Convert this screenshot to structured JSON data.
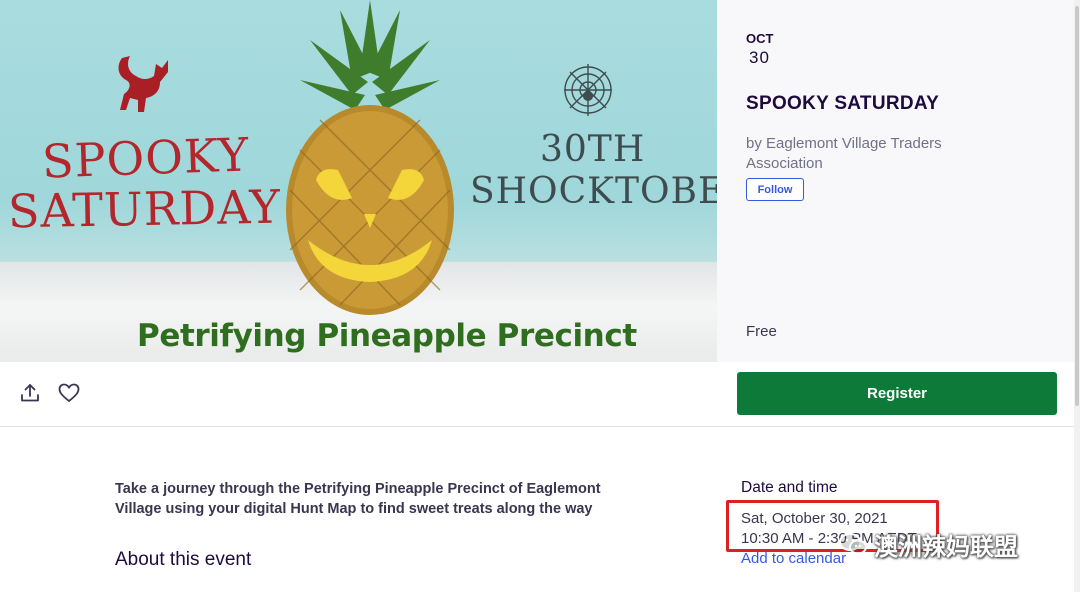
{
  "hero": {
    "title_line1": "SPOOKY",
    "title_line2": "SATURDAY",
    "subtitle_line1": "30TH",
    "subtitle_line2": "SHOCKTOBER",
    "caption": "Petrifying Pineapple Precinct"
  },
  "event": {
    "month": "OCT",
    "day": "30",
    "title": "SPOOKY SATURDAY",
    "organizer": "by Eaglemont Village Traders Association",
    "follow_label": "Follow",
    "price": "Free"
  },
  "actions": {
    "register_label": "Register"
  },
  "content": {
    "summary": "Take a journey through the Petrifying Pineapple Precinct of Eaglemont Village using your digital Hunt Map to find sweet treats along the way",
    "about_heading": "About this event"
  },
  "date_time": {
    "heading": "Date and time",
    "date": "Sat, October 30, 2021",
    "time": "10:30 AM - 2:30 PM AEDT",
    "add_to_calendar": "Add to calendar"
  },
  "watermark": {
    "text": "澳洲辣妈联盟"
  },
  "colors": {
    "register_green": "#0e7a3a",
    "link_blue": "#3659e3",
    "title_navy": "#1e0a3c",
    "highlight_red": "#e02020",
    "hero_red": "#b3262b",
    "caption_green": "#2f6e1f"
  }
}
